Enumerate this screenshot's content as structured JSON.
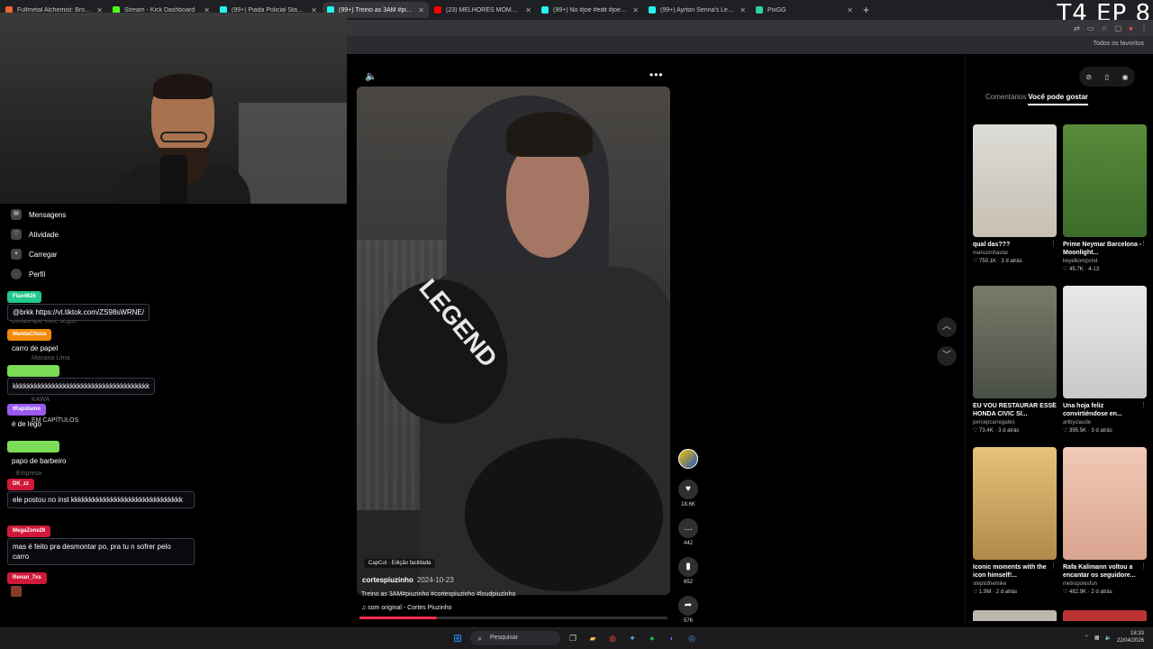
{
  "episode_label": "T4 EP 8",
  "tabs": [
    {
      "title": "Fullmetal Alchemist: Brotherhood",
      "color": "#e8662f",
      "active": false
    },
    {
      "title": "Stream - Kick Dashboard",
      "color": "#53fc18",
      "active": false
    },
    {
      "title": "(99+) Piada Policial Stand Up co",
      "color": "#25f4ee",
      "active": false
    },
    {
      "title": "(99+) Treino as 3AM #piuzinho",
      "color": "#25f4ee",
      "active": true
    },
    {
      "title": "(23) MELHORES MOMENTOS: F",
      "color": "#ff0000",
      "active": false
    },
    {
      "title": "(99+) No #joe #edit #joegoldb",
      "color": "#25f4ee",
      "active": false
    },
    {
      "title": "(99+) Ayrton Senna's Legendary",
      "color": "#25f4ee",
      "active": false
    },
    {
      "title": "PixGG",
      "color": "#2bd4a4",
      "active": false
    }
  ],
  "bookmarks": {
    "all_favorites": "Todos os favoritos"
  },
  "sidebar": {
    "items": [
      {
        "label": "Mensagens",
        "icon": "message-icon"
      },
      {
        "label": "Atividade",
        "icon": "activity-icon"
      },
      {
        "label": "Carregar",
        "icon": "upload-icon"
      },
      {
        "label": "Perfil",
        "icon": "profile-icon"
      }
    ],
    "following_label": "Contas que você segue",
    "accounts": [
      "Mariana Lima",
      "KAWA",
      "EM CAPÍTULOS"
    ],
    "company_label": "Empresa"
  },
  "chat": [
    {
      "user": "Flan4626",
      "color": "#22c98b",
      "message": "@brkk https://vt.tiktok.com/ZS98sWRNE/",
      "boxed": true
    },
    {
      "user": "MandaChuva",
      "color": "#f08a0c",
      "message": "carro de papel",
      "boxed": false
    },
    {
      "user": "",
      "color": "#7ddc57",
      "message": "kkkkkkkkkkkkkkkkkkkkkkkkkkkkkkkkkkkkkk",
      "boxed": true
    },
    {
      "user": "tRapidamo",
      "color": "#9b59f0",
      "message": "é de lego",
      "boxed": false
    },
    {
      "user": "",
      "color": "#7ddc57",
      "message": "papo de barbeiro",
      "boxed": false
    },
    {
      "user": "DK_zz",
      "color": "#d0193a",
      "message": "ele postou no inst kkkkkkkkkkkkkkkkkkkkkkkkkkkkkkk",
      "boxed": true
    },
    {
      "user": "MegaZone26",
      "color": "#d0193a",
      "message": "mas é feito pra desmontar po, pra tu n sofrer pelo carro",
      "boxed": true
    },
    {
      "user": "Renan_7xs",
      "color": "#d0193a",
      "message": "",
      "boxed": false
    }
  ],
  "video": {
    "glove_text": "LEGEND",
    "capcut_label": "CapCut · Edição facilitada",
    "author": "cortespiuzinho",
    "date": "2024-10-23",
    "caption": "Treino as 3AM#piuzinho #cortespiuzinho #loudpiuzinho",
    "sound": "som original - Cortes Piuzinho",
    "progress": 0.25
  },
  "actions": {
    "likes": "18.6K",
    "comments": "442",
    "saves": "652",
    "shares": "576"
  },
  "right_panel": {
    "tabs": [
      "Comentários",
      "Você pode gostar"
    ],
    "cards": [
      {
        "title": "qual das???",
        "author": "manuzinhastar",
        "likes": "750.1K",
        "ago": "3 d atrás",
        "bg": "linear-gradient(180deg,#dcdcd6,#c7bfb3)"
      },
      {
        "title": "Prime Neymar Barcelona - Moonlight...",
        "author": "keyelkompshd",
        "likes": "45.7K",
        "ago": "4-13",
        "bg": "linear-gradient(180deg,#5a8a3a,#3c6b2a)"
      },
      {
        "title": "EU VOU RESTAURAR ESSE HONDA CIVIC SI...",
        "author": "percepcarregates",
        "likes": "73.4K",
        "ago": "3 d atrás",
        "bg": "linear-gradient(180deg,#7a7a6a,#4a4f45)"
      },
      {
        "title": "Una hoja feliz convirtiéndose en...",
        "author": "artbyclaude",
        "likes": "395.5K",
        "ago": "3 d atrás",
        "bg": "linear-gradient(180deg,#e9e9e9,#c8c8c8)"
      },
      {
        "title": "Iconic moments with the icon himself!...",
        "author": "steptothemike",
        "likes": "1.9M",
        "ago": "2 d atrás",
        "bg": "linear-gradient(180deg,#e6c27a,#b08a4a)"
      },
      {
        "title": "Rafa Kalimann voltou a encantar os seguidore...",
        "author": "metropolesfun",
        "likes": "482.9K",
        "ago": "2 d atrás",
        "bg": "linear-gradient(180deg,#f0c9b5,#d9a48f)"
      }
    ]
  },
  "taskbar": {
    "search_placeholder": "Pesquisar",
    "time": "18:33",
    "date": "22/04/2026"
  }
}
